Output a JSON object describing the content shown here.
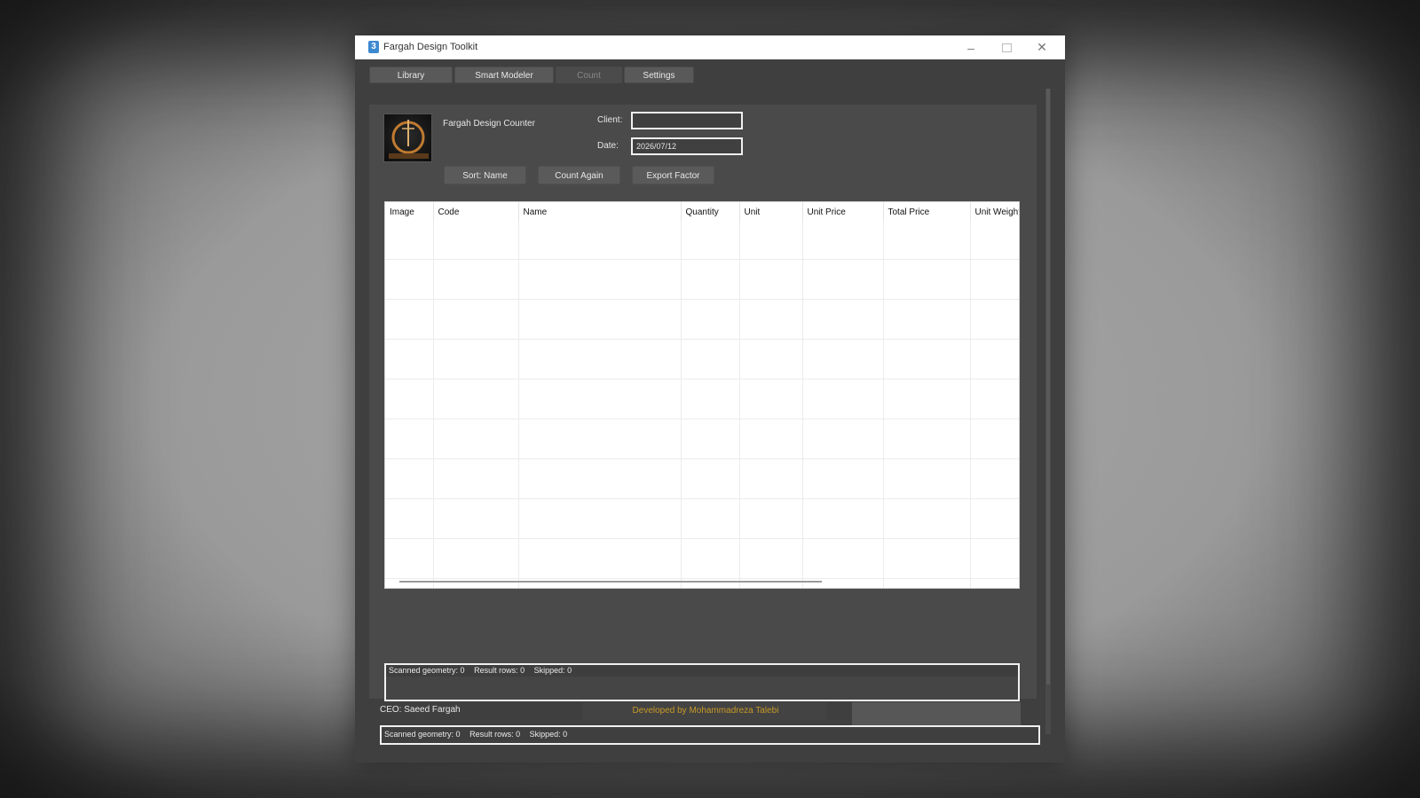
{
  "window": {
    "title": "Fargah Design Toolkit",
    "icon": "app-icon"
  },
  "tabs": [
    {
      "label": "Library",
      "enabled": true
    },
    {
      "label": "Smart Modeler",
      "enabled": true
    },
    {
      "label": "Count",
      "enabled": false
    },
    {
      "label": "Settings",
      "enabled": true
    }
  ],
  "counter": {
    "title": "Fargah Design Counter",
    "client_label": "Client:",
    "client_value": "",
    "date_label": "Date:",
    "date_value": "2026/07/12",
    "buttons": {
      "sort": "Sort: Name",
      "count_again": "Count Again",
      "export": "Export Factor"
    }
  },
  "table": {
    "columns": [
      "Image",
      "Code",
      "Name",
      "Quantity",
      "Unit",
      "Unit Price",
      "Total Price",
      "Unit Weight"
    ],
    "rows": []
  },
  "log": {
    "scanned": "Scanned geometry: 0",
    "result_rows": "Result rows: 0",
    "skipped": "Skipped: 0"
  },
  "footer": {
    "ceo": "CEO: Saeed Fargah",
    "developer": "Developed by Mohammadreza Talebi",
    "developer_color": "#c89a28"
  },
  "status": {
    "scanned": "Scanned geometry: 0",
    "result_rows": "Result rows: 0",
    "skipped": "Skipped: 0"
  }
}
